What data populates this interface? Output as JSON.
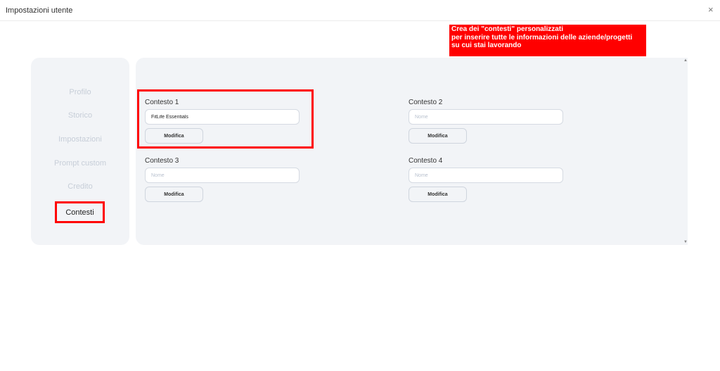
{
  "window": {
    "title": "Impostazioni utente",
    "close_icon": "×"
  },
  "callout": {
    "lines": [
      "Crea dei \"contesti\" personalizzati",
      "per inserire  tutte le informazioni delle aziende/progetti",
      "su cui stai lavorando"
    ],
    "color": "#ff0000"
  },
  "sidebar": {
    "items": [
      {
        "label": "Profilo"
      },
      {
        "label": "Storico"
      },
      {
        "label": "Impostazioni"
      },
      {
        "label": "Prompt custom"
      },
      {
        "label": "Credito"
      },
      {
        "label": "Contesti",
        "active": true
      }
    ]
  },
  "contexts": [
    {
      "label": "Contesto 1",
      "value": "FitLife Essentials",
      "placeholder": "Nome",
      "button": "Modifica"
    },
    {
      "label": "Contesto 2",
      "value": "",
      "placeholder": "Nome",
      "button": "Modifica"
    },
    {
      "label": "Contesto 3",
      "value": "",
      "placeholder": "Nome",
      "button": "Modifica"
    },
    {
      "label": "Contesto 4",
      "value": "",
      "placeholder": "Nome",
      "button": "Modifica"
    }
  ],
  "scrollbar": {
    "up_icon": "▲",
    "down_icon": "▼"
  },
  "colors": {
    "highlight": "#ff0000",
    "panel_bg": "#f2f4f7",
    "inactive_nav": "#c7ced8"
  }
}
